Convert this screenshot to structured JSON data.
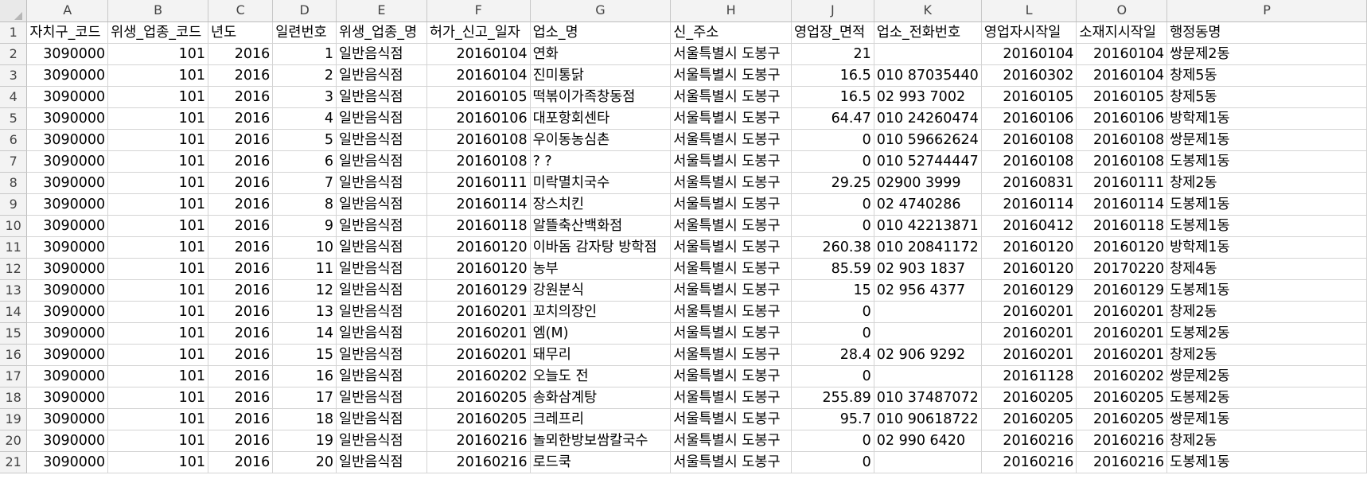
{
  "columns": [
    "A",
    "B",
    "C",
    "D",
    "E",
    "F",
    "G",
    "H",
    "J",
    "K",
    "L",
    "O",
    "P"
  ],
  "header": [
    "자치구_코드",
    "위생_업종_코드",
    "년도",
    "일련번호",
    "위생_업종_명",
    "허가_신고_일자",
    "업소_명",
    "신_주소",
    "영업장_면적",
    "업소_전화번호",
    "영업자시작일",
    "소재지시작일",
    "행정동명"
  ],
  "rows": [
    {
      "n": "2",
      "c": [
        "3090000",
        "101",
        "2016",
        "1",
        "일반음식점",
        "20160104",
        "연화",
        "서울특별시 도봉구",
        "21",
        "",
        "20160104",
        "20160104",
        "쌍문제2동"
      ]
    },
    {
      "n": "3",
      "c": [
        "3090000",
        "101",
        "2016",
        "2",
        "일반음식점",
        "20160104",
        "진미통닭",
        "서울특별시 도봉구",
        "16.5",
        "010 87035440",
        "20160302",
        "20160104",
        "창제5동"
      ]
    },
    {
      "n": "4",
      "c": [
        "3090000",
        "101",
        "2016",
        "3",
        "일반음식점",
        "20160105",
        "떡볶이가족창동점",
        "서울특별시 도봉구",
        "16.5",
        "02  993 7002",
        "20160105",
        "20160105",
        "창제5동"
      ]
    },
    {
      "n": "5",
      "c": [
        "3090000",
        "101",
        "2016",
        "4",
        "일반음식점",
        "20160106",
        "대포항회센타",
        "서울특별시 도봉구",
        "64.47",
        "010 24260474",
        "20160106",
        "20160106",
        "방학제1동"
      ]
    },
    {
      "n": "6",
      "c": [
        "3090000",
        "101",
        "2016",
        "5",
        "일반음식점",
        "20160108",
        "우이동농심촌",
        "서울특별시 도봉구",
        "0",
        "010 59662624",
        "20160108",
        "20160108",
        "쌍문제1동"
      ]
    },
    {
      "n": "7",
      "c": [
        "3090000",
        "101",
        "2016",
        "6",
        "일반음식점",
        "20160108",
        "? ?",
        "서울특별시 도봉구",
        "0",
        "010 52744447",
        "20160108",
        "20160108",
        "도봉제1동"
      ]
    },
    {
      "n": "8",
      "c": [
        "3090000",
        "101",
        "2016",
        "7",
        "일반음식점",
        "20160111",
        "미락멸치국수",
        "서울특별시 도봉구",
        "29.25",
        "  02900 3999",
        "20160831",
        "20160111",
        "창제2동"
      ]
    },
    {
      "n": "9",
      "c": [
        "3090000",
        "101",
        "2016",
        "8",
        "일반음식점",
        "20160114",
        "장스치킨",
        "서울특별시 도봉구",
        "0",
        "  02 4740286",
        "20160114",
        "20160114",
        "도봉제1동"
      ]
    },
    {
      "n": "10",
      "c": [
        "3090000",
        "101",
        "2016",
        "9",
        "일반음식점",
        "20160118",
        "알뜰축산백화점",
        "서울특별시 도봉구",
        "0",
        "010 42213871",
        "20160412",
        "20160118",
        "도봉제1동"
      ]
    },
    {
      "n": "11",
      "c": [
        "3090000",
        "101",
        "2016",
        "10",
        "일반음식점",
        "20160120",
        "이바돔 감자탕 방학점",
        "서울특별시 도봉구",
        "260.38",
        "010 20841172",
        "20160120",
        "20160120",
        "방학제1동"
      ]
    },
    {
      "n": "12",
      "c": [
        "3090000",
        "101",
        "2016",
        "11",
        "일반음식점",
        "20160120",
        "농부",
        "서울특별시 도봉구",
        "85.59",
        "02  903 1837",
        "20160120",
        "20170220",
        "창제4동"
      ]
    },
    {
      "n": "13",
      "c": [
        "3090000",
        "101",
        "2016",
        "12",
        "일반음식점",
        "20160129",
        "강원분식",
        "서울특별시 도봉구",
        "15",
        "02  956 4377",
        "20160129",
        "20160129",
        "도봉제1동"
      ]
    },
    {
      "n": "14",
      "c": [
        "3090000",
        "101",
        "2016",
        "13",
        "일반음식점",
        "20160201",
        "꼬치의장인",
        "서울특별시 도봉구",
        "0",
        "",
        "20160201",
        "20160201",
        "창제2동"
      ]
    },
    {
      "n": "15",
      "c": [
        "3090000",
        "101",
        "2016",
        "14",
        "일반음식점",
        "20160201",
        "엠(M)",
        "서울특별시 도봉구",
        "0",
        "",
        "20160201",
        "20160201",
        "도봉제2동"
      ]
    },
    {
      "n": "16",
      "c": [
        "3090000",
        "101",
        "2016",
        "15",
        "일반음식점",
        "20160201",
        "돼무리",
        "서울특별시 도봉구",
        "28.4",
        "02  906 9292",
        "20160201",
        "20160201",
        "창제2동"
      ]
    },
    {
      "n": "17",
      "c": [
        "3090000",
        "101",
        "2016",
        "16",
        "일반음식점",
        "20160202",
        "오늘도 전",
        "서울특별시 도봉구",
        "0",
        "",
        "20161128",
        "20160202",
        "쌍문제2동"
      ]
    },
    {
      "n": "18",
      "c": [
        "3090000",
        "101",
        "2016",
        "17",
        "일반음식점",
        "20160205",
        "송화삼계탕",
        "서울특별시 도봉구",
        "255.89",
        "010 37487072",
        "20160205",
        "20160205",
        "도봉제2동"
      ]
    },
    {
      "n": "19",
      "c": [
        "3090000",
        "101",
        "2016",
        "18",
        "일반음식점",
        "20160205",
        "크레프리",
        "서울특별시 도봉구",
        "95.7",
        "010 90618722",
        "20160205",
        "20160205",
        "쌍문제1동"
      ]
    },
    {
      "n": "20",
      "c": [
        "3090000",
        "101",
        "2016",
        "19",
        "일반음식점",
        "20160216",
        "놀뫼한방보쌈칼국수",
        "서울특별시 도봉구",
        "0",
        "02  990 6420",
        "20160216",
        "20160216",
        "창제2동"
      ]
    },
    {
      "n": "21",
      "c": [
        "3090000",
        "101",
        "2016",
        "20",
        "일반음식점",
        "20160216",
        "로드쿡",
        "서울특별시 도봉구",
        "0",
        "",
        "20160216",
        "20160216",
        "도봉제1동"
      ]
    }
  ],
  "header_row_number": "1",
  "colors": {
    "header_bg": "#f3f3f3",
    "gridline": "#d4d4d4"
  }
}
